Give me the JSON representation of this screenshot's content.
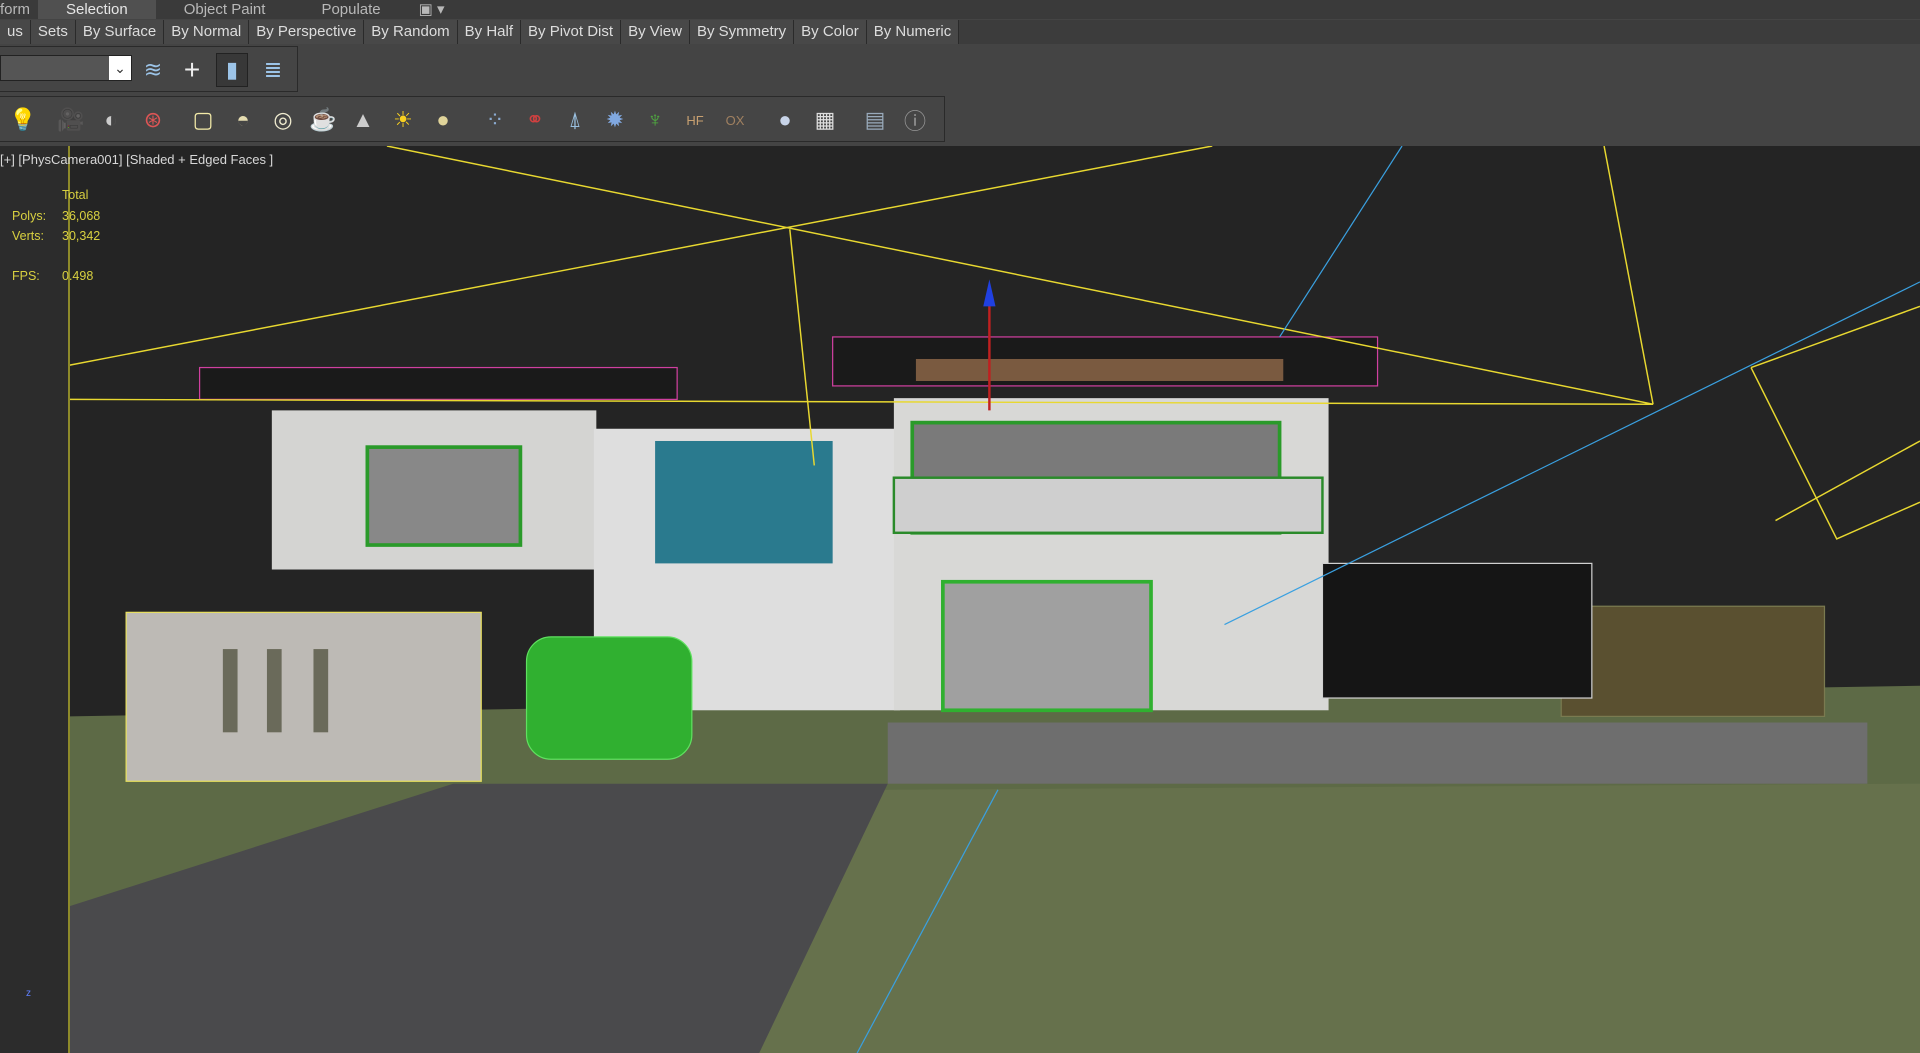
{
  "tabs": [
    {
      "label": "form"
    },
    {
      "label": "Selection",
      "active": true
    },
    {
      "label": "Object Paint"
    },
    {
      "label": "Populate"
    }
  ],
  "ribbon": [
    "us",
    "Sets",
    "By Surface",
    "By Normal",
    "By Perspective",
    "By Random",
    "By Half",
    "By Pivot Dist",
    "By View",
    "By Symmetry",
    "By Color",
    "By Numeric"
  ],
  "toolbar1": {
    "combo_value": "",
    "icons": [
      "layer-select-icon",
      "add-icon",
      "select-object-icon",
      "select-layer-icon"
    ]
  },
  "toolbar2": {
    "icons": [
      "light-lister-icon",
      "camera-icon",
      "camera-target-icon",
      "film-camera-icon",
      "plane-icon",
      "dome-icon",
      "sphere-light-icon",
      "teapot-icon",
      "cone-icon",
      "sun-icon",
      "sphere-icon",
      "particles-icon",
      "molecule-icon",
      "tripod-icon",
      "gear-sphere-icon",
      "grass-icon",
      "hair-icon",
      "ox-icon",
      "material-sphere-icon",
      "material-editor-icon",
      "render-setup-icon",
      "help-icon"
    ]
  },
  "viewport": {
    "label": "[+] [PhysCamera001] [Shaded + Edged Faces ]",
    "stats": {
      "header": "Total",
      "polys_label": "Polys:",
      "polys": "36,068",
      "verts_label": "Verts:",
      "verts": "30,342",
      "fps_label": "FPS:",
      "fps": "0.498"
    },
    "axis_label": "z"
  },
  "colors": {
    "camera_lines": "#e8d830",
    "grass": "#5d6a46",
    "selection_border": "#c8b820"
  }
}
